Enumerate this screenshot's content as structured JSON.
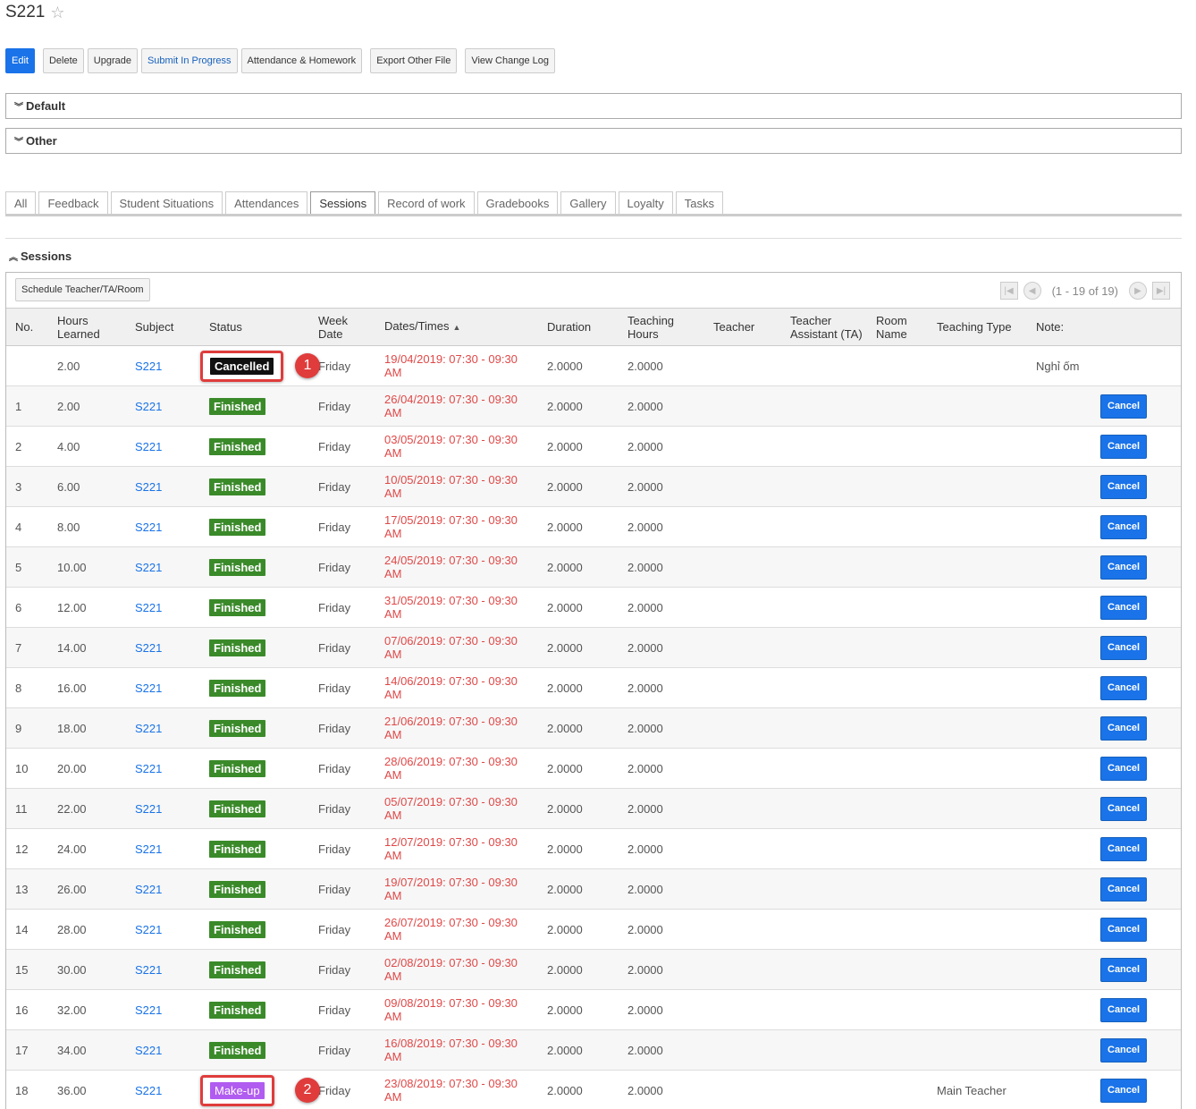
{
  "page": {
    "title": "S221"
  },
  "toolbar": {
    "edit": "Edit",
    "delete": "Delete",
    "upgrade": "Upgrade",
    "submit": "Submit In Progress",
    "attendance": "Attendance & Homework",
    "export": "Export Other File",
    "changelog": "View Change Log"
  },
  "panels": {
    "default": "Default",
    "other": "Other"
  },
  "tabs": [
    "All",
    "Feedback",
    "Student Situations",
    "Attendances",
    "Sessions",
    "Record of work",
    "Gradebooks",
    "Gallery",
    "Loyalty",
    "Tasks"
  ],
  "active_tab": "Sessions",
  "section": {
    "title": "Sessions",
    "schedule_button": "Schedule Teacher/TA/Room",
    "pager_text": "(1 - 19 of 19)"
  },
  "columns": [
    "No.",
    "Hours Learned",
    "Subject",
    "Status",
    "Week Date",
    "Dates/Times",
    "Duration",
    "Teaching Hours",
    "Teacher",
    "Teacher Assistant (TA)",
    "Room Name",
    "Teaching Type",
    "Note:"
  ],
  "rows": [
    {
      "no": "",
      "hours": "2.00",
      "subject": "S221",
      "status": "Cancelled",
      "week": "Friday",
      "date": "19/04/2019: 07:30 - 09:30 AM",
      "duration": "2.0000",
      "teaching_hours": "2.0000",
      "teacher": "",
      "ta": "",
      "room": "",
      "type": "",
      "note": "Nghỉ ốm",
      "action": "",
      "marker": "1"
    },
    {
      "no": "1",
      "hours": "2.00",
      "subject": "S221",
      "status": "Finished",
      "week": "Friday",
      "date": "26/04/2019: 07:30 - 09:30 AM",
      "duration": "2.0000",
      "teaching_hours": "2.0000",
      "teacher": "",
      "ta": "",
      "room": "",
      "type": "",
      "note": "",
      "action": "Cancel"
    },
    {
      "no": "2",
      "hours": "4.00",
      "subject": "S221",
      "status": "Finished",
      "week": "Friday",
      "date": "03/05/2019: 07:30 - 09:30 AM",
      "duration": "2.0000",
      "teaching_hours": "2.0000",
      "teacher": "",
      "ta": "",
      "room": "",
      "type": "",
      "note": "",
      "action": "Cancel"
    },
    {
      "no": "3",
      "hours": "6.00",
      "subject": "S221",
      "status": "Finished",
      "week": "Friday",
      "date": "10/05/2019: 07:30 - 09:30 AM",
      "duration": "2.0000",
      "teaching_hours": "2.0000",
      "teacher": "",
      "ta": "",
      "room": "",
      "type": "",
      "note": "",
      "action": "Cancel"
    },
    {
      "no": "4",
      "hours": "8.00",
      "subject": "S221",
      "status": "Finished",
      "week": "Friday",
      "date": "17/05/2019: 07:30 - 09:30 AM",
      "duration": "2.0000",
      "teaching_hours": "2.0000",
      "teacher": "",
      "ta": "",
      "room": "",
      "type": "",
      "note": "",
      "action": "Cancel"
    },
    {
      "no": "5",
      "hours": "10.00",
      "subject": "S221",
      "status": "Finished",
      "week": "Friday",
      "date": "24/05/2019: 07:30 - 09:30 AM",
      "duration": "2.0000",
      "teaching_hours": "2.0000",
      "teacher": "",
      "ta": "",
      "room": "",
      "type": "",
      "note": "",
      "action": "Cancel"
    },
    {
      "no": "6",
      "hours": "12.00",
      "subject": "S221",
      "status": "Finished",
      "week": "Friday",
      "date": "31/05/2019: 07:30 - 09:30 AM",
      "duration": "2.0000",
      "teaching_hours": "2.0000",
      "teacher": "",
      "ta": "",
      "room": "",
      "type": "",
      "note": "",
      "action": "Cancel"
    },
    {
      "no": "7",
      "hours": "14.00",
      "subject": "S221",
      "status": "Finished",
      "week": "Friday",
      "date": "07/06/2019: 07:30 - 09:30 AM",
      "duration": "2.0000",
      "teaching_hours": "2.0000",
      "teacher": "",
      "ta": "",
      "room": "",
      "type": "",
      "note": "",
      "action": "Cancel"
    },
    {
      "no": "8",
      "hours": "16.00",
      "subject": "S221",
      "status": "Finished",
      "week": "Friday",
      "date": "14/06/2019: 07:30 - 09:30 AM",
      "duration": "2.0000",
      "teaching_hours": "2.0000",
      "teacher": "",
      "ta": "",
      "room": "",
      "type": "",
      "note": "",
      "action": "Cancel"
    },
    {
      "no": "9",
      "hours": "18.00",
      "subject": "S221",
      "status": "Finished",
      "week": "Friday",
      "date": "21/06/2019: 07:30 - 09:30 AM",
      "duration": "2.0000",
      "teaching_hours": "2.0000",
      "teacher": "",
      "ta": "",
      "room": "",
      "type": "",
      "note": "",
      "action": "Cancel"
    },
    {
      "no": "10",
      "hours": "20.00",
      "subject": "S221",
      "status": "Finished",
      "week": "Friday",
      "date": "28/06/2019: 07:30 - 09:30 AM",
      "duration": "2.0000",
      "teaching_hours": "2.0000",
      "teacher": "",
      "ta": "",
      "room": "",
      "type": "",
      "note": "",
      "action": "Cancel"
    },
    {
      "no": "11",
      "hours": "22.00",
      "subject": "S221",
      "status": "Finished",
      "week": "Friday",
      "date": "05/07/2019: 07:30 - 09:30 AM",
      "duration": "2.0000",
      "teaching_hours": "2.0000",
      "teacher": "",
      "ta": "",
      "room": "",
      "type": "",
      "note": "",
      "action": "Cancel"
    },
    {
      "no": "12",
      "hours": "24.00",
      "subject": "S221",
      "status": "Finished",
      "week": "Friday",
      "date": "12/07/2019: 07:30 - 09:30 AM",
      "duration": "2.0000",
      "teaching_hours": "2.0000",
      "teacher": "",
      "ta": "",
      "room": "",
      "type": "",
      "note": "",
      "action": "Cancel"
    },
    {
      "no": "13",
      "hours": "26.00",
      "subject": "S221",
      "status": "Finished",
      "week": "Friday",
      "date": "19/07/2019: 07:30 - 09:30 AM",
      "duration": "2.0000",
      "teaching_hours": "2.0000",
      "teacher": "",
      "ta": "",
      "room": "",
      "type": "",
      "note": "",
      "action": "Cancel"
    },
    {
      "no": "14",
      "hours": "28.00",
      "subject": "S221",
      "status": "Finished",
      "week": "Friday",
      "date": "26/07/2019: 07:30 - 09:30 AM",
      "duration": "2.0000",
      "teaching_hours": "2.0000",
      "teacher": "",
      "ta": "",
      "room": "",
      "type": "",
      "note": "",
      "action": "Cancel"
    },
    {
      "no": "15",
      "hours": "30.00",
      "subject": "S221",
      "status": "Finished",
      "week": "Friday",
      "date": "02/08/2019: 07:30 - 09:30 AM",
      "duration": "2.0000",
      "teaching_hours": "2.0000",
      "teacher": "",
      "ta": "",
      "room": "",
      "type": "",
      "note": "",
      "action": "Cancel"
    },
    {
      "no": "16",
      "hours": "32.00",
      "subject": "S221",
      "status": "Finished",
      "week": "Friday",
      "date": "09/08/2019: 07:30 - 09:30 AM",
      "duration": "2.0000",
      "teaching_hours": "2.0000",
      "teacher": "",
      "ta": "",
      "room": "",
      "type": "",
      "note": "",
      "action": "Cancel"
    },
    {
      "no": "17",
      "hours": "34.00",
      "subject": "S221",
      "status": "Finished",
      "week": "Friday",
      "date": "16/08/2019: 07:30 - 09:30 AM",
      "duration": "2.0000",
      "teaching_hours": "2.0000",
      "teacher": "",
      "ta": "",
      "room": "",
      "type": "",
      "note": "",
      "action": "Cancel"
    },
    {
      "no": "18",
      "hours": "36.00",
      "subject": "S221",
      "status": "Make-up",
      "week": "Friday",
      "date": "23/08/2019: 07:30 - 09:30 AM",
      "duration": "2.0000",
      "teaching_hours": "2.0000",
      "teacher": "",
      "ta": "",
      "room": "",
      "type": "Main Teacher",
      "note": "",
      "action": "Cancel",
      "marker": "2"
    }
  ],
  "colors": {
    "primary": "#1a73e8",
    "finished": "#3a8a2a",
    "cancelled": "#111111",
    "makeup": "#b15cf0",
    "date": "#e04848",
    "highlight": "#e03c3c"
  }
}
